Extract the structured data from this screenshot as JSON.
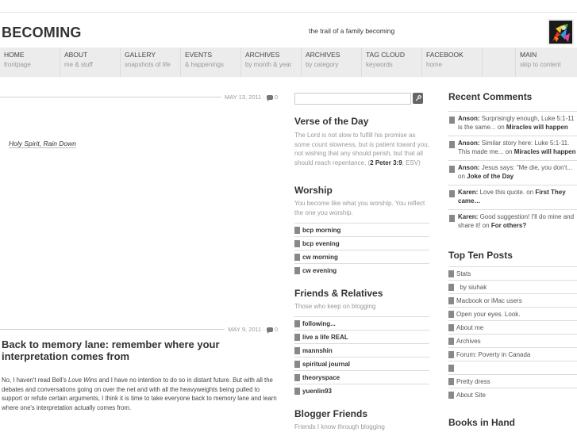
{
  "header": {
    "site_title": "BECOMING",
    "tagline": "the trail of a family becoming",
    "avatar_icon": "colorful-avatar-image"
  },
  "nav": [
    {
      "label": "HOME",
      "sub": "frontpage"
    },
    {
      "label": "ABOUT",
      "sub": "me & stuff"
    },
    {
      "label": "GALLERY",
      "sub": "snapshots of life"
    },
    {
      "label": "EVENTS",
      "sub": "& happenings"
    },
    {
      "label": "ARCHIVES",
      "sub": "by month & year"
    },
    {
      "label": "ARCHIVES",
      "sub": "by category"
    },
    {
      "label": "TAG CLOUD",
      "sub": "keywords"
    },
    {
      "label": "FACEBOOK",
      "sub": "home"
    },
    {
      "label": "",
      "sub": ""
    },
    {
      "label": "MAIN",
      "sub": "skip to content"
    }
  ],
  "posts": [
    {
      "date": "MAY 13, 2011",
      "comments": "0",
      "link_text": "Holy Spirit, Rain Down"
    },
    {
      "date": "MAY 9, 2011",
      "comments": "0",
      "title": "Back to memory lane: remember where your interpretation comes from",
      "body_p1_a": "No, I haven't read Bell's ",
      "body_p1_em": "Love Wins",
      "body_p1_b": " and I have no intention to do so in distant future. But with all the debates and conversations going on over the net and with all the heavyweights being pulled to support or refute certain arguments, I think it is time to take everyone back to memory lane and learn where one's interpretation actually comes from."
    }
  ],
  "search": {
    "placeholder": "",
    "value": "",
    "button_icon": "search-key-icon"
  },
  "verse": {
    "title": "Verse of the Day",
    "text": "The Lord is not slow to fulfill his promise as some count slowness, but is patient toward you, not wishing that any should perish, but that all should reach repentance. (",
    "ref": "2 Peter 3:9",
    "version": ", ESV)"
  },
  "worship": {
    "title": "Worship",
    "subtitle": "You become like what you worship. You reflect the one you worship.",
    "links": [
      "bcp morning",
      "bcp evening",
      "cw morning",
      "cw evening"
    ]
  },
  "friends": {
    "title": "Friends & Relatives",
    "subtitle": "Those who keep on blogging",
    "links": [
      "following...",
      "live a life REAL",
      "mannshin",
      "spiritual journal",
      "theoryspace",
      "yuenlin93"
    ]
  },
  "blogger_friends": {
    "title": "Blogger Friends",
    "subtitle": "Friends I know through blogging"
  },
  "recent_comments": {
    "title": "Recent Comments",
    "items": [
      {
        "author": "Anson:",
        "text": " Surprisingly enough, Luke 5:1-11 is the same... on ",
        "post": "Miracles will happen"
      },
      {
        "author": "Anson:",
        "text": " Similar story here: Luke 5:1-11. This made me... on ",
        "post": "Miracles will happen"
      },
      {
        "author": "Anson:",
        "text": " Jesus says: \"Me die, you don't... on ",
        "post": "Joke of the Day"
      },
      {
        "author": "Karen:",
        "text": " Love this quote. on ",
        "post": "First They came…"
      },
      {
        "author": "Karen:",
        "text": " Good suggestion! I'll do mine and share it! on ",
        "post": "For others?"
      }
    ]
  },
  "top_posts": {
    "title": "Top Ten Posts",
    "items": [
      "Stats",
      "  by siuhak",
      "Macbook or iMac users",
      "Open your eyes. Look.",
      "About me",
      "Archives",
      "Forum: Poverty in Canada",
      "",
      "Pretty dress",
      "About Site"
    ]
  },
  "books": {
    "title": "Books in Hand"
  }
}
